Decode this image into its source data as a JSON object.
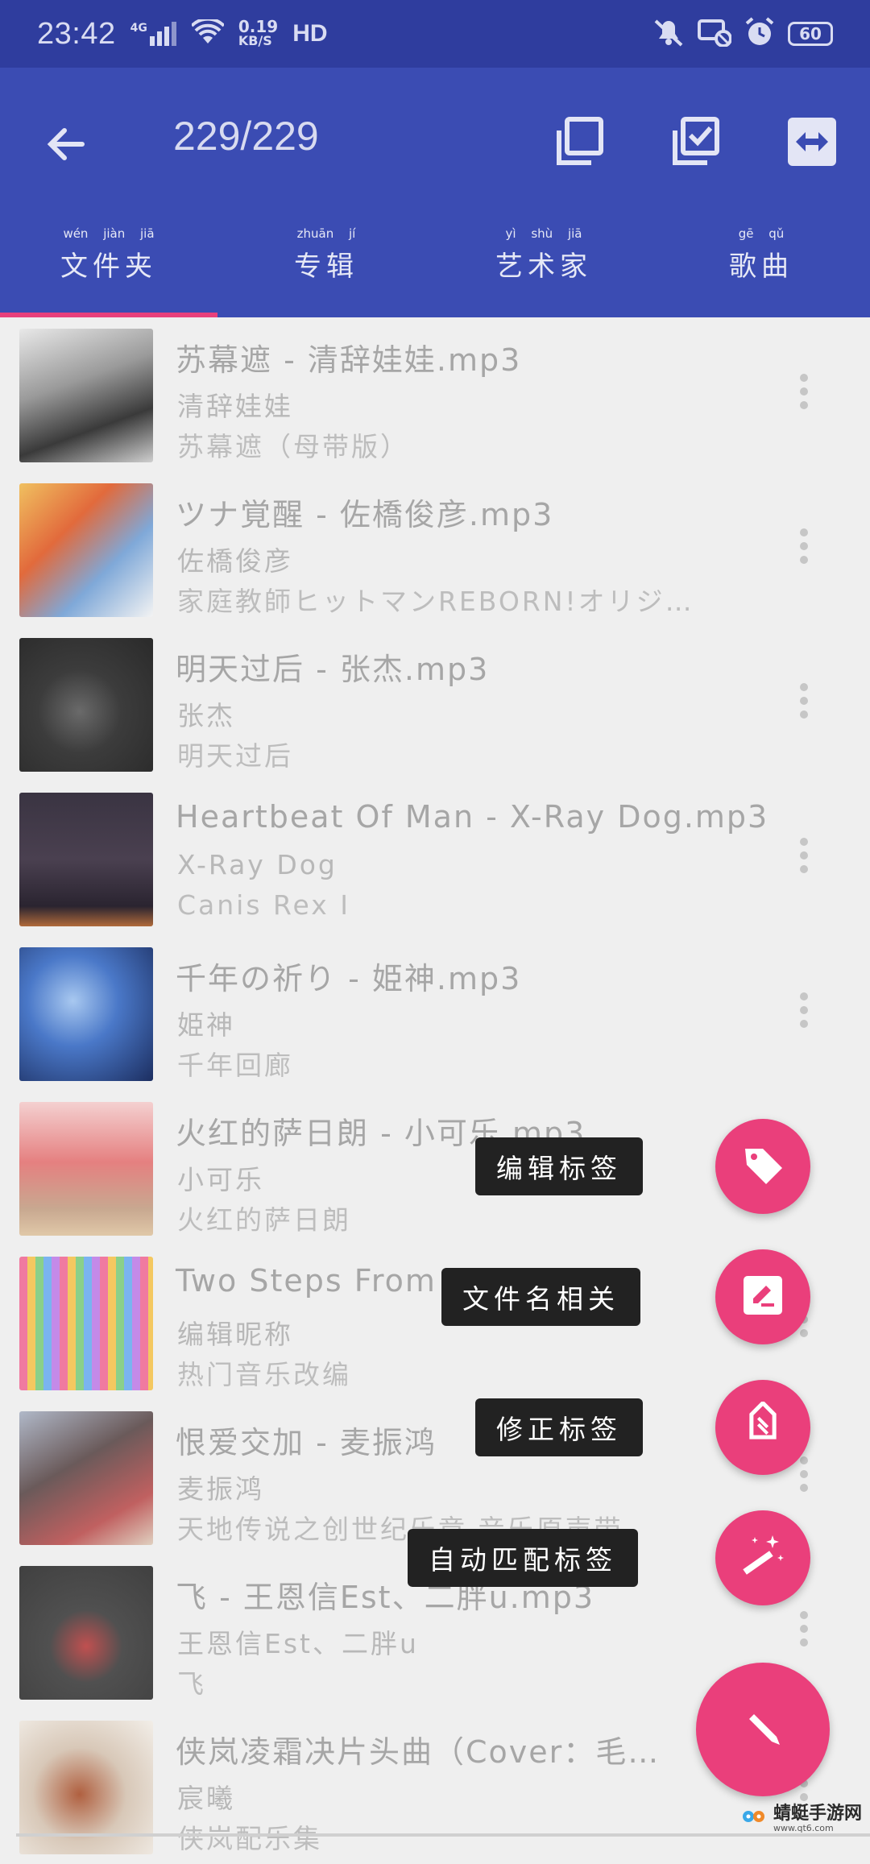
{
  "status_bar": {
    "time": "23:42",
    "net_top": "4G",
    "speed_top": "0.19",
    "speed_bottom": "KB/S",
    "hd": "HD",
    "battery": "60"
  },
  "header": {
    "count": "229/229",
    "icons": [
      "back-arrow-icon",
      "select-copy-icon",
      "select-all-icon",
      "swap-icon"
    ]
  },
  "tabs": [
    {
      "label": "文件夹",
      "pinyin": "wén jiàn jiā",
      "active": true
    },
    {
      "label": "专辑",
      "pinyin": "zhuān jí",
      "active": false
    },
    {
      "label": "艺术家",
      "pinyin": "yì shù jiā",
      "active": false
    },
    {
      "label": "歌曲",
      "pinyin": "gē qǔ",
      "active": false
    }
  ],
  "songs": [
    {
      "title": "苏幕遮 - 清辞娃娃.mp3",
      "artist": "清辞娃娃",
      "album": "苏幕遮（母带版）"
    },
    {
      "title": "ツナ覚醒 - 佐橋俊彦.mp3",
      "artist": "佐橋俊彦",
      "album": "家庭教師ヒットマンREBORN!オリジ…"
    },
    {
      "title": "明天过后 - 张杰.mp3",
      "artist": "张杰",
      "album": "明天过后"
    },
    {
      "title": "Heartbeat Of Man - X-Ray Dog.mp3",
      "artist": "X-Ray Dog",
      "album": "Canis Rex I"
    },
    {
      "title": "千年の祈り - 姫神.mp3",
      "artist": "姫神",
      "album": "千年回廊"
    },
    {
      "title": "火红的萨日朗 - 小可乐.mp3",
      "artist": "小可乐",
      "album": "火红的萨日朗"
    },
    {
      "title": "Two Steps From",
      "artist": "编辑昵称",
      "album": "热门音乐改编"
    },
    {
      "title": "恨爱交加 - 麦振鸿",
      "artist": "麦振鸿",
      "album": "天地传说之创世纪乐章 音乐原声带"
    },
    {
      "title": "飞 - 王恩信Est、二胖u.mp3",
      "artist": "王恩信Est、二胖u",
      "album": "飞"
    },
    {
      "title": "侠岚凌霜决片头曲（Cover：毛…",
      "artist": "宸曦",
      "album": "侠岚配乐集"
    }
  ],
  "fab_menu": [
    {
      "label": "编辑标签",
      "icon": "tag-icon"
    },
    {
      "label": "文件名相关",
      "icon": "edit-box-icon"
    },
    {
      "label": "修正标签",
      "icon": "tag-fix-icon"
    },
    {
      "label": "自动匹配标签",
      "icon": "magic-wand-icon"
    }
  ],
  "fab_main_icon": "pencil-icon",
  "watermark": {
    "text": "蜻蜓手游网",
    "url": "www.qt6.com"
  },
  "colors": {
    "primary": "#3b4cb3",
    "status": "#2f3d9e",
    "accent": "#ea3f7b"
  }
}
